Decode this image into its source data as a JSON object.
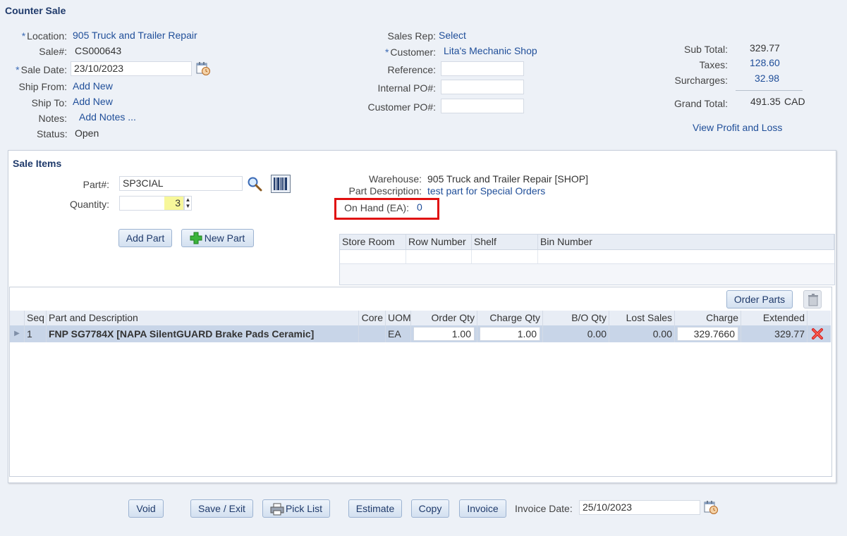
{
  "page": {
    "title": "Counter Sale"
  },
  "header": {
    "location_label": "Location:",
    "location_value": "905 Truck and Trailer Repair",
    "sale_no_label": "Sale#:",
    "sale_no_value": "CS000643",
    "sale_date_label": "Sale Date:",
    "sale_date_value": "23/10/2023",
    "ship_from_label": "Ship From:",
    "ship_from_link": "Add New",
    "ship_to_label": "Ship To:",
    "ship_to_link": "Add New",
    "notes_label": "Notes:",
    "notes_link": "Add Notes ...",
    "status_label": "Status:",
    "status_value": "Open",
    "required_mark": "*",
    "sales_rep_label": "Sales Rep:",
    "sales_rep_link": "Select",
    "customer_label": "Customer:",
    "customer_value": "Lita's Mechanic Shop",
    "reference_label": "Reference:",
    "reference_value": "",
    "internal_po_label": "Internal PO#:",
    "internal_po_value": "",
    "customer_po_label": "Customer PO#:",
    "customer_po_value": ""
  },
  "totals": {
    "sub_total_label": "Sub Total:",
    "sub_total_value": "329.77",
    "taxes_label": "Taxes:",
    "taxes_value": "128.60",
    "surcharges_label": "Surcharges:",
    "surcharges_value": "32.98",
    "grand_total_label": "Grand Total:",
    "grand_total_value": "491.35",
    "currency": "CAD",
    "profit_link": "View Profit and Loss"
  },
  "sale_items": {
    "title": "Sale Items",
    "part_label": "Part#:",
    "part_value": "SP3CIAL",
    "quantity_label": "Quantity:",
    "quantity_value": "3",
    "add_part_button": "Add Part",
    "new_part_button": "New Part",
    "warehouse_label": "Warehouse:",
    "warehouse_value": "905 Truck and Trailer Repair [SHOP]",
    "part_desc_label": "Part Description:",
    "part_desc_value": "test part for Special Orders",
    "on_hand_label": "On Hand (EA):",
    "on_hand_value": "0",
    "bin_columns": [
      "Store Room",
      "Row Number",
      "Shelf",
      "Bin Number"
    ]
  },
  "lines": {
    "order_parts_button": "Order Parts",
    "columns": {
      "seq": "Seq",
      "part": "Part and Description",
      "core": "Core",
      "uom": "UOM",
      "order_qty": "Order Qty",
      "charge_qty": "Charge Qty",
      "bo_qty": "B/O Qty",
      "lost_sales": "Lost Sales",
      "charge": "Charge",
      "extended": "Extended"
    },
    "rows": [
      {
        "seq": "1",
        "part": "FNP SG7784X [NAPA SilentGUARD Brake Pads Ceramic]",
        "core": "",
        "uom": "EA",
        "order_qty": "1.00",
        "charge_qty": "1.00",
        "bo_qty": "0.00",
        "lost_sales": "0.00",
        "charge": "329.7660",
        "extended": "329.77"
      }
    ]
  },
  "footer": {
    "void_button": "Void",
    "save_exit_button": "Save / Exit",
    "pick_list_button": "Pick List",
    "estimate_button": "Estimate",
    "copy_button": "Copy",
    "invoice_button": "Invoice",
    "invoice_date_label": "Invoice Date:",
    "invoice_date_value": "25/10/2023"
  },
  "colors": {
    "background": "#edf1f7",
    "link": "#1f4e99",
    "title": "#1f3a6b",
    "highlight_box": "#e01010",
    "selected_row": "#c8d5e8",
    "quantity_highlight": "#f7f79a"
  }
}
